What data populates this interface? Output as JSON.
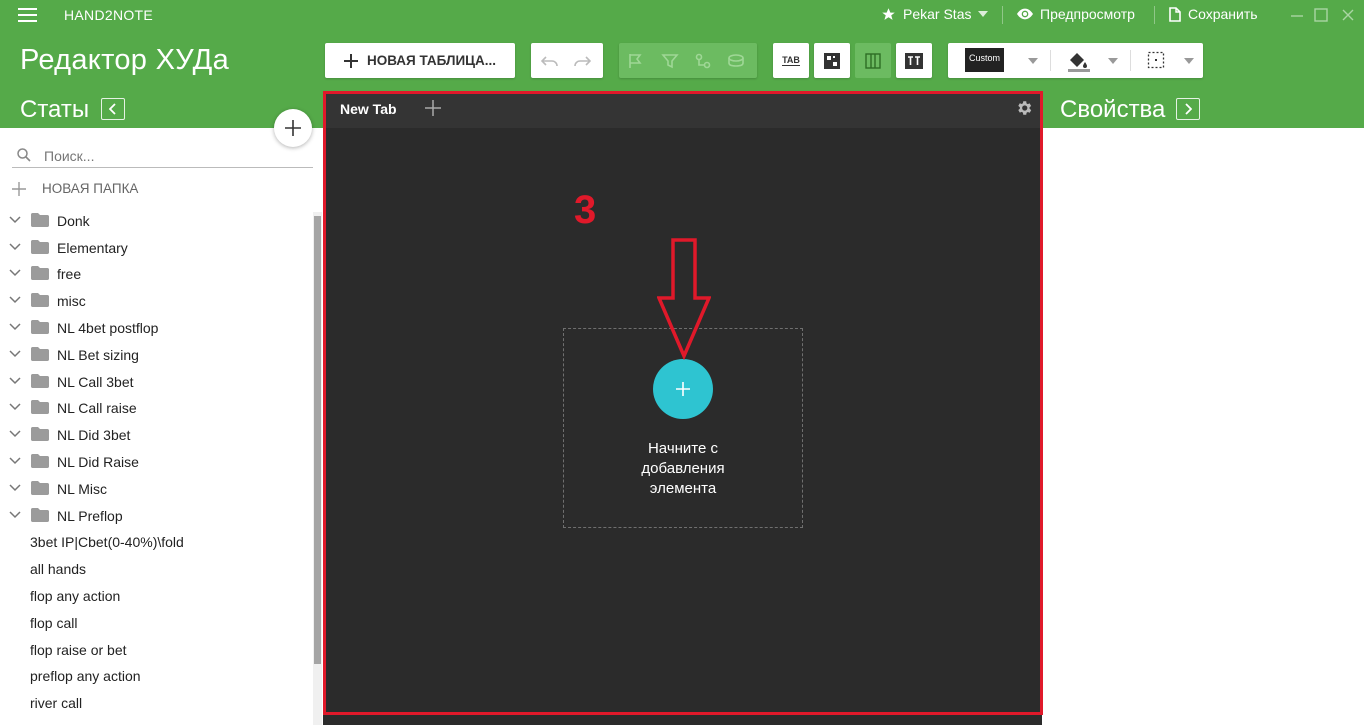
{
  "titlebar": {
    "app_name": "HAND2NOTE",
    "user_name": "Pekar Stas",
    "preview_label": "Предпросмотр",
    "save_label": "Сохранить"
  },
  "header": {
    "editor_title": "Редактор ХУДа",
    "stats_title": "Статы",
    "properties_title": "Свойства",
    "new_table_label": "НОВАЯ ТАБЛИЦА...",
    "tab_button_label": "TAB",
    "custom_label": "Custom"
  },
  "sidebar": {
    "search_placeholder": "Поиск...",
    "new_folder_label": "НОВАЯ ПАПКА",
    "folders": [
      {
        "label": "Donk"
      },
      {
        "label": "Elementary"
      },
      {
        "label": "free"
      },
      {
        "label": "misc"
      },
      {
        "label": "NL 4bet postflop"
      },
      {
        "label": "NL Bet sizing"
      },
      {
        "label": "NL Call 3bet"
      },
      {
        "label": "NL Call raise"
      },
      {
        "label": "NL Did 3bet"
      },
      {
        "label": "NL Did Raise"
      },
      {
        "label": "NL Misc"
      },
      {
        "label": "NL Preflop"
      }
    ],
    "stats": [
      {
        "label": "3bet IP|Cbet(0-40%)\\fold"
      },
      {
        "label": "all hands"
      },
      {
        "label": "flop any action"
      },
      {
        "label": "flop call"
      },
      {
        "label": "flop raise or bet"
      },
      {
        "label": "preflop any action"
      },
      {
        "label": "river call"
      }
    ]
  },
  "editor": {
    "tab_label": "New Tab",
    "drop_text_line1": "Начните с",
    "drop_text_line2": "добавления",
    "drop_text_line3": "элемента",
    "annotation_number": "3"
  },
  "colors": {
    "brand_green": "#55aa49",
    "accent_cyan": "#2ec4d1",
    "annotation_red": "#e0192a",
    "editor_bg": "#2b2b2b"
  }
}
